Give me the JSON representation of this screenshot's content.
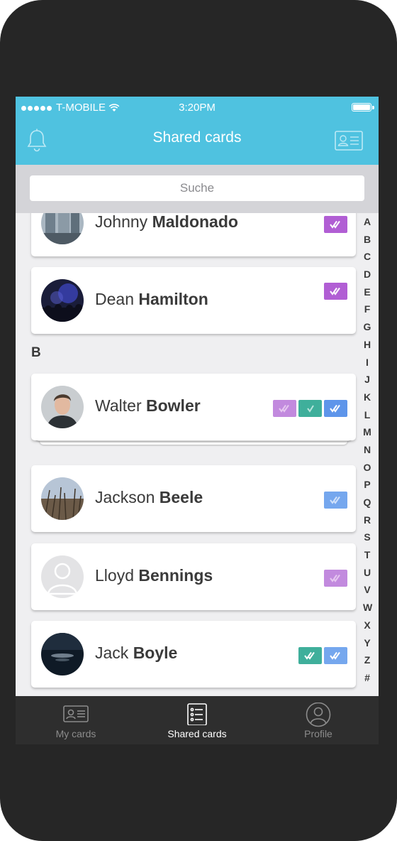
{
  "status_bar": {
    "carrier": "T-MOBILE",
    "time": "3:20PM"
  },
  "header": {
    "title": "Shared cards"
  },
  "search": {
    "placeholder": "Suche"
  },
  "contacts": [
    {
      "first": "Johnny",
      "last": "Maldonado",
      "badges": [
        "purple"
      ]
    },
    {
      "first": "Dean",
      "last": "Hamilton",
      "badges": [
        "purple"
      ]
    },
    {
      "first": "Walter",
      "last": "Bowler",
      "badges": [
        "purple-light",
        "teal",
        "blue"
      ]
    },
    {
      "first": "Jackson",
      "last": "Beele",
      "badges": [
        "blue-light"
      ]
    },
    {
      "first": "Lloyd",
      "last": "Bennings",
      "badges": [
        "purple-light"
      ]
    },
    {
      "first": "Jack",
      "last": "Boyle",
      "badges": [
        "teal",
        "blue-light"
      ]
    }
  ],
  "section_letter": "B",
  "alphabet_index": [
    "A",
    "B",
    "C",
    "D",
    "E",
    "F",
    "G",
    "H",
    "I",
    "J",
    "K",
    "L",
    "M",
    "N",
    "O",
    "P",
    "Q",
    "R",
    "S",
    "T",
    "U",
    "V",
    "W",
    "X",
    "Y",
    "Z",
    "#"
  ],
  "tabs": [
    {
      "label": "My cards",
      "icon": "id-card-icon",
      "active": false
    },
    {
      "label": "Shared cards",
      "icon": "card-list-icon",
      "active": true
    },
    {
      "label": "Profile",
      "icon": "profile-icon",
      "active": false
    }
  ],
  "colors": {
    "header": "#4fc2e0",
    "purple": "#b15ed4",
    "teal": "#3faf9b",
    "blue": "#5e95ea",
    "tabbar": "#2e2e2e"
  }
}
